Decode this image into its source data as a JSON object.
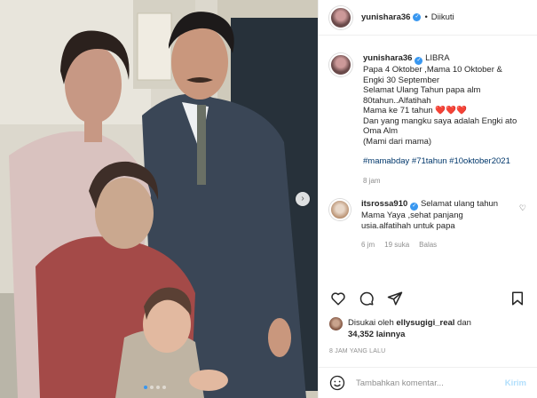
{
  "post": {
    "image_alt": "Vintage family photo",
    "carousel_dots": 4,
    "carousel_active_index": 0,
    "next_icon": "chevron-right-icon"
  },
  "header": {
    "username": "yunishara36",
    "separator": "•",
    "follow_status": "Diikuti"
  },
  "caption": {
    "username": "yunishara36",
    "lines": [
      "LIBRA",
      "Papa 4 Oktober ,Mama 10 Oktober &",
      "Engki 30 September",
      "Selamat Ulang Tahun papa alm",
      "80tahun..Alfatihah",
      "Mama ke 71 tahun ❤️❤️❤️",
      "Dan yang mangku saya adalah Engki ato",
      "Oma Alm",
      "(Mami dari mama)"
    ],
    "hashtags": "#mamabday #71tahun #10oktober2021",
    "time": "8 jam"
  },
  "comment": {
    "username": "itsrossa910",
    "text_lines": [
      "Selamat ulang tahun",
      "Mama Yaya ,sehat panjang",
      "usia.alfatihah untuk papa"
    ],
    "time": "6 jm",
    "likes": "19 suka",
    "reply": "Balas"
  },
  "likes": {
    "prefix": "Disukai oleh",
    "user": "ellysugigi_real",
    "conjunction": "dan",
    "count": "34,352 lainnya"
  },
  "timeago": "8 JAM YANG LALU",
  "add_comment": {
    "placeholder": "Tambahkan komentar...",
    "send_label": "Kirim"
  },
  "colors": {
    "verified": "#3897f0",
    "hashtag": "#00376b",
    "muted": "#8e8e8e",
    "send_disabled": "#b2dffc"
  }
}
